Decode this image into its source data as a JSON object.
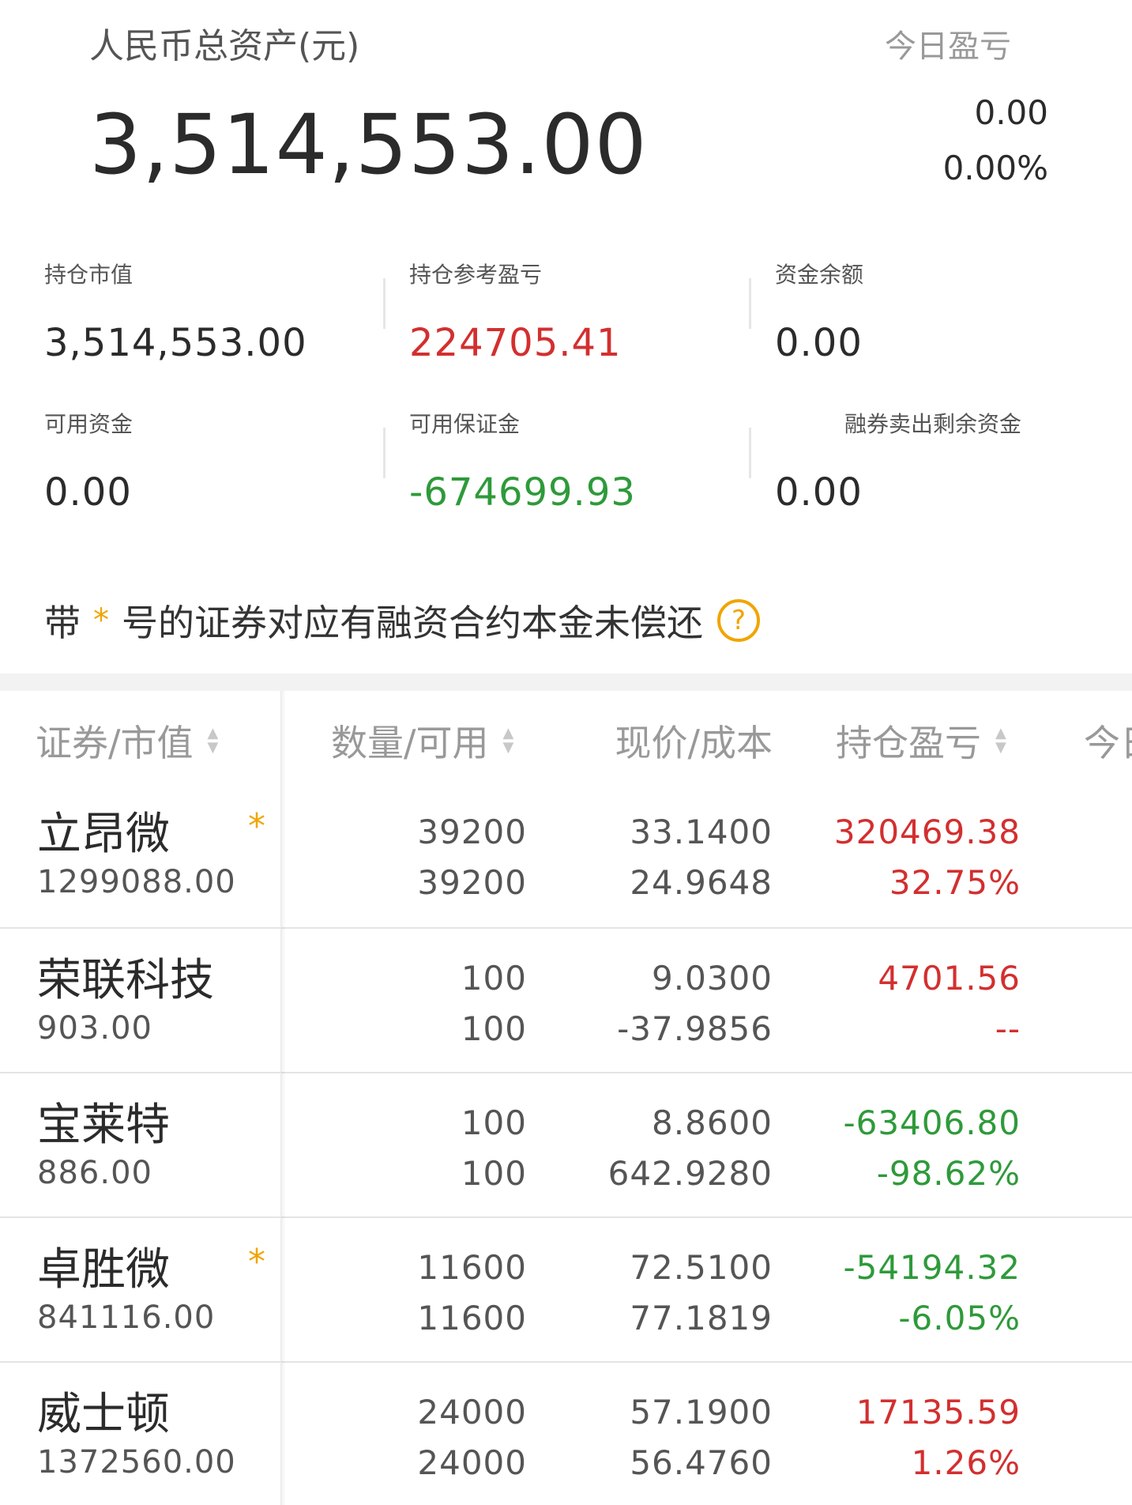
{
  "header": {
    "title": "人民币总资产(元)",
    "today_label": "今日盈亏",
    "total_assets": "3,514,553.00",
    "today_pl": "0.00",
    "today_pl_pct": "0.00%"
  },
  "stats": [
    {
      "label": "持仓市值",
      "value": "3,514,553.00",
      "color": "#2b2b2b"
    },
    {
      "label": "持仓参考盈亏",
      "value": "224705.41",
      "color": "#d32f2f"
    },
    {
      "label": "资金余额",
      "value": "0.00",
      "color": "#2b2b2b"
    },
    {
      "label": "可用资金",
      "value": "0.00",
      "color": "#2b2b2b"
    },
    {
      "label": "可用保证金",
      "value": "-674699.93",
      "color": "#2e9a3a"
    },
    {
      "label": "融券卖出剩余资金",
      "value": "0.00",
      "color": "#2b2b2b"
    }
  ],
  "notice": {
    "prefix": "带",
    "star": "*",
    "text": "号的证券对应有融资合约本金未偿还",
    "help_icon": "?"
  },
  "table": {
    "headers": [
      "证券/市值",
      "数量/可用",
      "现价/成本",
      "持仓盈亏",
      "今日"
    ],
    "rows": [
      {
        "name": "立昂微",
        "market_value": "1299088.00",
        "starred": true,
        "qty": "39200",
        "avail": "39200",
        "price": "33.1400",
        "cost": "24.9648",
        "pl": "320469.38",
        "pl_pct": "32.75%",
        "pl_color": "red"
      },
      {
        "name": "荣联科技",
        "market_value": "903.00",
        "starred": false,
        "qty": "100",
        "avail": "100",
        "price": "9.0300",
        "cost": "-37.9856",
        "pl": "4701.56",
        "pl_pct": "--",
        "pl_color": "red"
      },
      {
        "name": "宝莱特",
        "market_value": "886.00",
        "starred": false,
        "qty": "100",
        "avail": "100",
        "price": "8.8600",
        "cost": "642.9280",
        "pl": "-63406.80",
        "pl_pct": "-98.62%",
        "pl_color": "green"
      },
      {
        "name": "卓胜微",
        "market_value": "841116.00",
        "starred": true,
        "qty": "11600",
        "avail": "11600",
        "price": "72.5100",
        "cost": "77.1819",
        "pl": "-54194.32",
        "pl_pct": "-6.05%",
        "pl_color": "green"
      },
      {
        "name": "威士顿",
        "market_value": "1372560.00",
        "starred": false,
        "qty": "24000",
        "avail": "24000",
        "price": "57.1900",
        "cost": "56.4760",
        "pl": "17135.59",
        "pl_pct": "1.26%",
        "pl_color": "red"
      }
    ]
  },
  "colors": {
    "profit": "#d32f2f",
    "loss": "#2e9a3a",
    "accent": "#f0a500"
  }
}
